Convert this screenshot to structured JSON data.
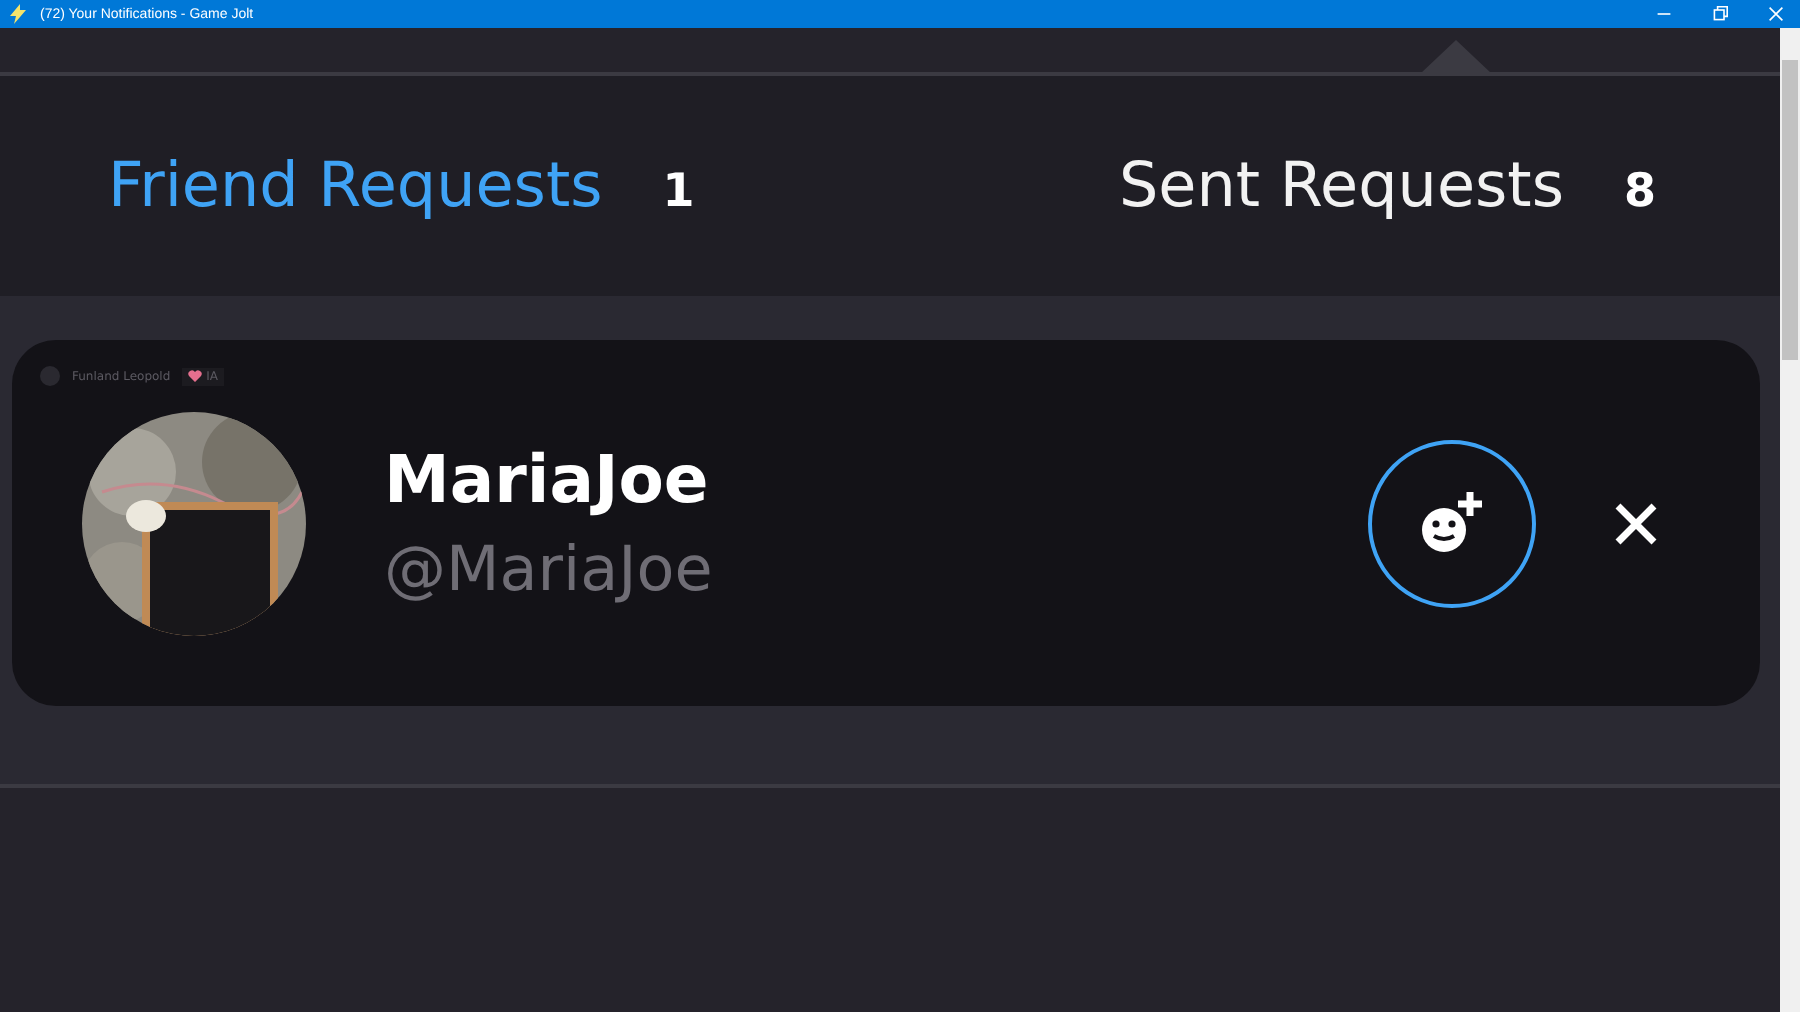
{
  "window": {
    "title": "(72) Your Notifications - Game Jolt"
  },
  "tabs": [
    {
      "label": "Friend Requests",
      "count": "1",
      "selected": true
    },
    {
      "label": "Sent Requests",
      "count": "8",
      "selected": false
    }
  ],
  "requests": [
    {
      "overlay_name": "Funland Leopold",
      "overlay_tag": "IA",
      "display_name": "MariaJoe",
      "username": "@MariaJoe"
    }
  ]
}
